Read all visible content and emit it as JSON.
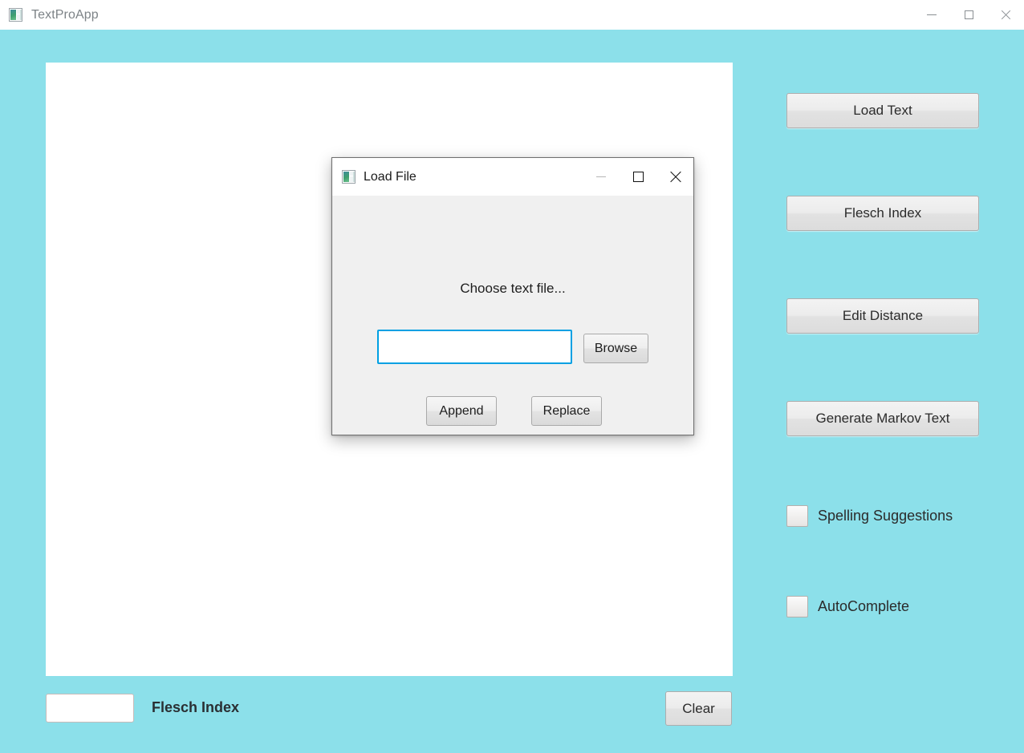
{
  "window": {
    "title": "TextProApp",
    "icon": "app-window-icon",
    "controls": {
      "minimize": "minimize-icon",
      "maximize": "maximize-icon",
      "close": "close-icon"
    }
  },
  "colors": {
    "background": "#8ce0ea",
    "editor_background": "#ffffff",
    "dialog_background": "#f0f0f0",
    "focus_border": "#00a0e3",
    "button_face": "#ececec"
  },
  "editor": {
    "value": "",
    "placeholder": ""
  },
  "sidebar": {
    "buttons": [
      {
        "label": "Load Text"
      },
      {
        "label": "Flesch Index"
      },
      {
        "label": "Edit Distance"
      },
      {
        "label": "Generate Markov Text"
      }
    ],
    "checkboxes": [
      {
        "label": "Spelling Suggestions",
        "checked": false
      },
      {
        "label": "AutoComplete",
        "checked": false
      }
    ]
  },
  "bottom_bar": {
    "flesch_value": "",
    "flesch_placeholder": "",
    "flesch_label": "Flesch Index",
    "clear_label": "Clear"
  },
  "dialog": {
    "title": "Load File",
    "icon": "app-window-icon",
    "controls": {
      "minimize": "minimize-icon",
      "maximize": "maximize-icon",
      "close": "close-icon"
    },
    "prompt": "Choose text file...",
    "file_path_value": "",
    "file_path_placeholder": "",
    "browse_label": "Browse",
    "append_label": "Append",
    "replace_label": "Replace"
  }
}
